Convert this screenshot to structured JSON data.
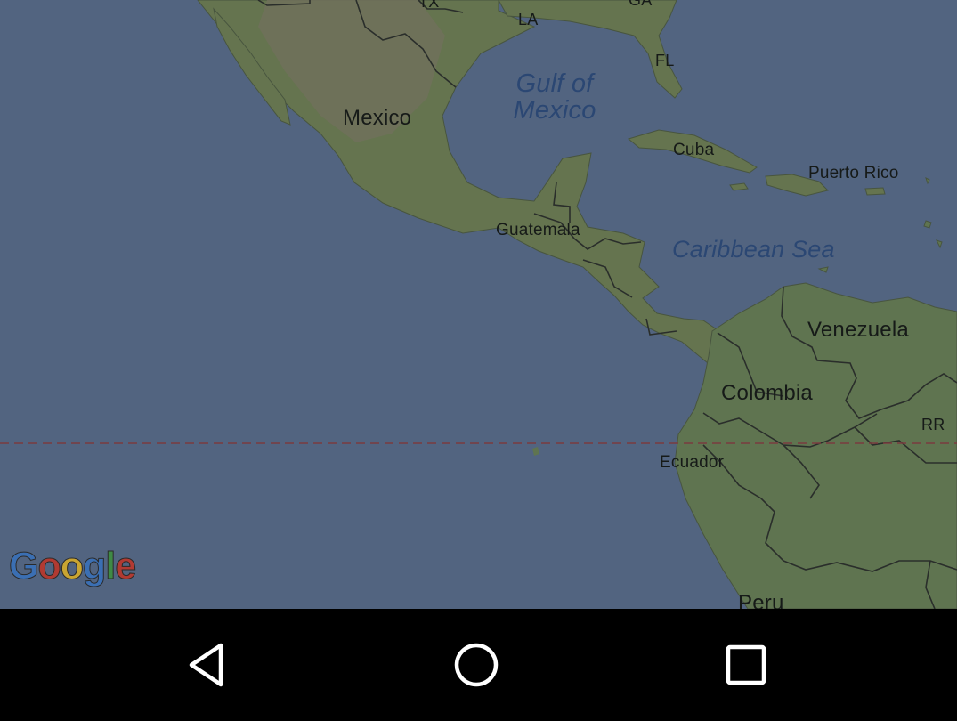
{
  "map": {
    "labels": {
      "tx": "TX",
      "la": "LA",
      "ga": "GA",
      "fl": "FL",
      "mexico": "Mexico",
      "gulf": "Gulf of Mexico",
      "cuba": "Cuba",
      "puerto_rico": "Puerto Rico",
      "guatemala": "Guatemala",
      "caribbean": "Caribbean Sea",
      "venezuela": "Venezuela",
      "colombia": "Colombia",
      "rr": "RR",
      "ecuador": "Ecuador",
      "peru": "Peru"
    },
    "equator_line": true,
    "colors": {
      "water": "#526480",
      "land": "#5e7352",
      "land_arid": "#6f7257",
      "border": "#2a2e2b",
      "equator": "#7a3b3f",
      "water_label": "#2b4773"
    }
  },
  "logo": {
    "text": "Google",
    "letters": [
      {
        "char": "G",
        "color": "#3b6fb3"
      },
      {
        "char": "o",
        "color": "#b13a32"
      },
      {
        "char": "o",
        "color": "#c9a532"
      },
      {
        "char": "g",
        "color": "#3b6fb3"
      },
      {
        "char": "l",
        "color": "#3f8a45"
      },
      {
        "char": "e",
        "color": "#b13a32"
      }
    ]
  },
  "navigation_bar": {
    "buttons": [
      "back",
      "home",
      "recents"
    ],
    "icon_color": "#ffffff",
    "background": "#000000"
  }
}
